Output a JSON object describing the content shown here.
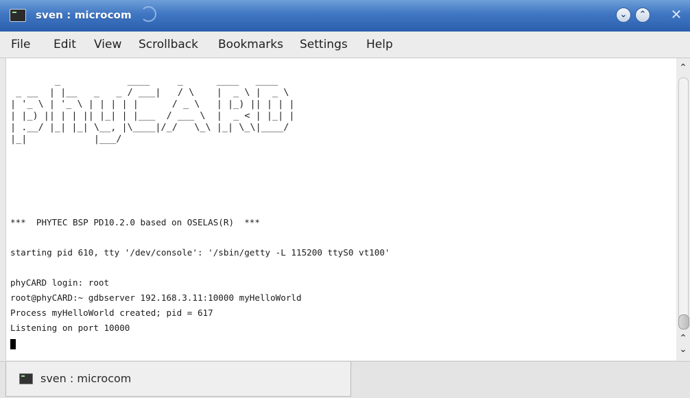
{
  "window": {
    "title": "sven : microcom",
    "icons": {
      "app": "terminal-icon",
      "minimize": "chevron-down-icon",
      "maximize": "chevron-up-icon",
      "close": "close-icon"
    },
    "minimize_glyph": "⌄",
    "maximize_glyph": "⌃",
    "close_glyph": "✕"
  },
  "menu": {
    "items": [
      "File",
      "Edit",
      "View",
      "Scrollback",
      "Bookmarks",
      "Settings",
      "Help"
    ]
  },
  "terminal": {
    "ascii_banner": [
      "        _            ____     _      ____   ____",
      " _ __  | |__   _   _ / ___|   / \\    |  _ \\ |  _ \\",
      "| '_ \\ | '_ \\ | | | | |      / _ \\   | |_) || | | |",
      "| |_) || | | || |_| | |___  / ___ \\  |  _ < | |_| |",
      "| .__/ |_| |_| \\__, |\\____|/_/   \\_\\ |_| \\_\\|____/",
      "|_|            |___/"
    ],
    "lines": [
      "***  PHYTEC BSP PD10.2.0 based on OSELAS(R)  ***",
      "starting pid 610, tty '/dev/console': '/sbin/getty -L 115200 ttyS0 vt100'",
      "phyCARD login: root",
      "root@phyCARD:~ gdbserver 192.168.3.11:10000 myHelloWorld",
      "Process myHelloWorld created; pid = 617",
      "Listening on port 10000"
    ]
  },
  "scrollbar": {
    "up_glyph": "⌃",
    "down_glyph": "⌄"
  },
  "tabs": [
    {
      "label": "sven : microcom",
      "icon": "terminal-icon",
      "active": true
    }
  ]
}
